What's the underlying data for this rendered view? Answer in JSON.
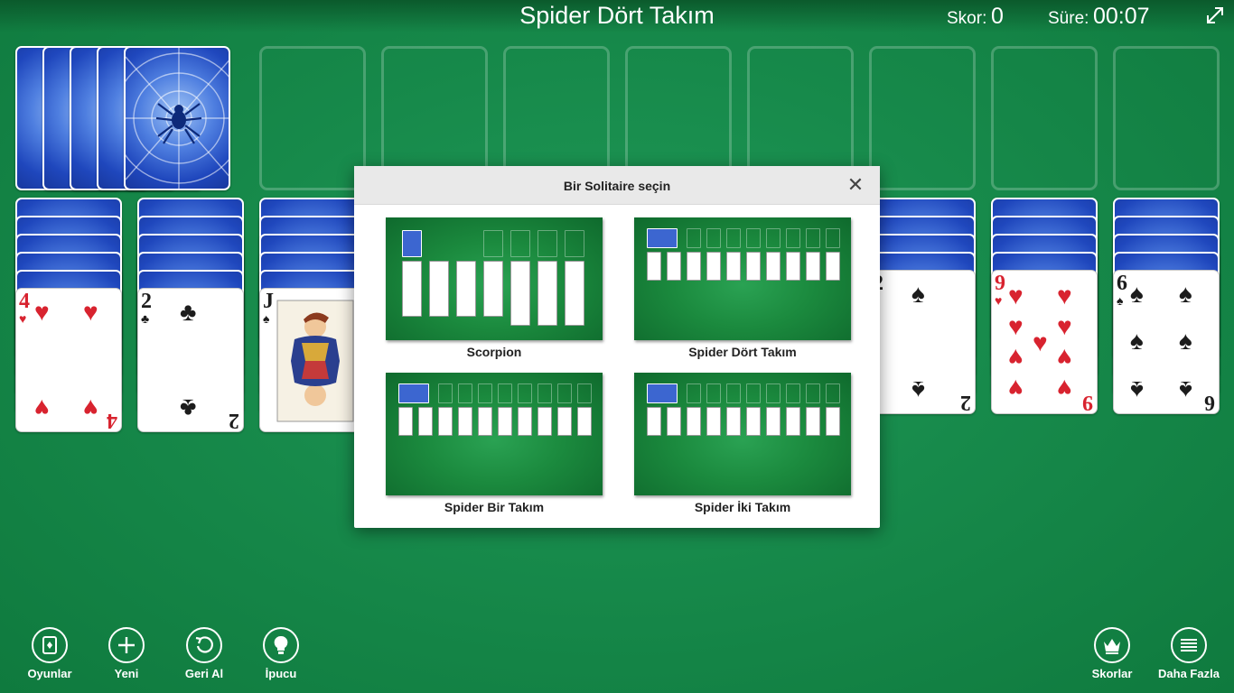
{
  "header": {
    "title": "Spider Dört Takım",
    "score_label": "Skor:",
    "score_value": "0",
    "time_label": "Süre:",
    "time_value": "00:07"
  },
  "tableau_visible_cards": [
    {
      "rank": "4",
      "suit": "♥",
      "color": "red"
    },
    {
      "rank": "2",
      "suit": "♣",
      "color": "black"
    },
    {
      "rank": "J",
      "suit": "♠",
      "color": "black"
    },
    {
      "rank": "2",
      "suit": "♠",
      "color": "black"
    },
    {
      "rank": "9",
      "suit": "♥",
      "color": "red"
    },
    {
      "rank": "6",
      "suit": "♠",
      "color": "black"
    }
  ],
  "dialog": {
    "title": "Bir Solitaire seçin",
    "close_icon": "close-icon",
    "options": [
      {
        "label": "Scorpion"
      },
      {
        "label": "Spider Dört Takım"
      },
      {
        "label": "Spider Bir Takım"
      },
      {
        "label": "Spider İki Takım"
      }
    ]
  },
  "toolbar": {
    "games": "Oyunlar",
    "new": "Yeni",
    "undo": "Geri Al",
    "hint": "İpucu",
    "scores": "Skorlar",
    "more": "Daha Fazla"
  },
  "colors": {
    "felt": "#178a4b",
    "card_back": "#2a52c8",
    "red_suit": "#d8232f",
    "black_suit": "#1c1c1c"
  }
}
